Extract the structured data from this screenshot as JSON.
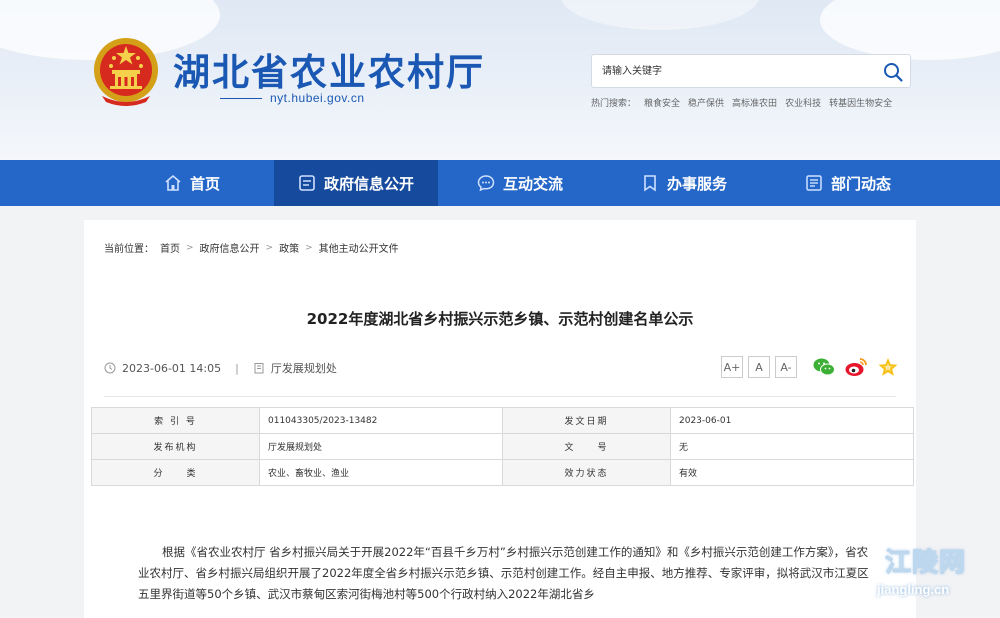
{
  "header": {
    "site_title": "湖北省农业农村厅",
    "site_url": "nyt.hubei.gov.cn",
    "search_placeholder": "请输入关键字",
    "hot_label": "热门搜索：",
    "hot_keywords": [
      "粮食安全",
      "稳产保供",
      "高标准农田",
      "农业科技",
      "转基因生物安全"
    ]
  },
  "nav": {
    "items": [
      {
        "label": "首页",
        "icon": "home-icon"
      },
      {
        "label": "政府信息公开",
        "icon": "list-icon",
        "active": true
      },
      {
        "label": "互动交流",
        "icon": "chat-icon"
      },
      {
        "label": "办事服务",
        "icon": "bookmark-icon"
      },
      {
        "label": "部门动态",
        "icon": "news-icon"
      }
    ]
  },
  "breadcrumb": {
    "label": "当前位置：",
    "items": [
      "首页",
      "政府信息公开",
      "政策",
      "其他主动公开文件"
    ]
  },
  "article": {
    "title": "2022年度湖北省乡村振兴示范乡镇、示范村创建名单公示",
    "datetime": "2023-06-01 14:05",
    "department": "厅发展规划处",
    "font_sizes": [
      "A+",
      "A",
      "A-"
    ],
    "share_icons": [
      "wechat-icon",
      "weibo-icon",
      "favorite-icon"
    ]
  },
  "info": {
    "rows": [
      {
        "l1": "索 引 号",
        "v1": "011043305/2023-13482",
        "l2": "发文日期",
        "v2": "2023-06-01"
      },
      {
        "l1": "发布机构",
        "v1": "厅发展规划处",
        "l2": "文　　号",
        "v2": "无"
      },
      {
        "l1": "分　　类",
        "v1": "农业、畜牧业、渔业",
        "l2": "效力状态",
        "v2": "有效"
      }
    ]
  },
  "body": {
    "paragraph": "根据《省农业农村厅 省乡村振兴局关于开展2022年“百县千乡万村”乡村振兴示范创建工作的通知》和《乡村振兴示范创建工作方案》，省农业农村厅、省乡村振兴局组织开展了2022年度全省乡村振兴示范乡镇、示范村创建工作。经自主申报、地方推荐、专家评审，拟将武汉市江夏区五里界街道等50个乡镇、武汉市蔡甸区索河街梅池村等500个行政村纳入2022年湖北省乡"
  },
  "watermark": {
    "cn": "江陵网",
    "en": "jiangling.cn"
  },
  "colors": {
    "brand_blue": "#2567c9",
    "nav_active": "#164a9c",
    "title_blue": "#1a58b3"
  }
}
